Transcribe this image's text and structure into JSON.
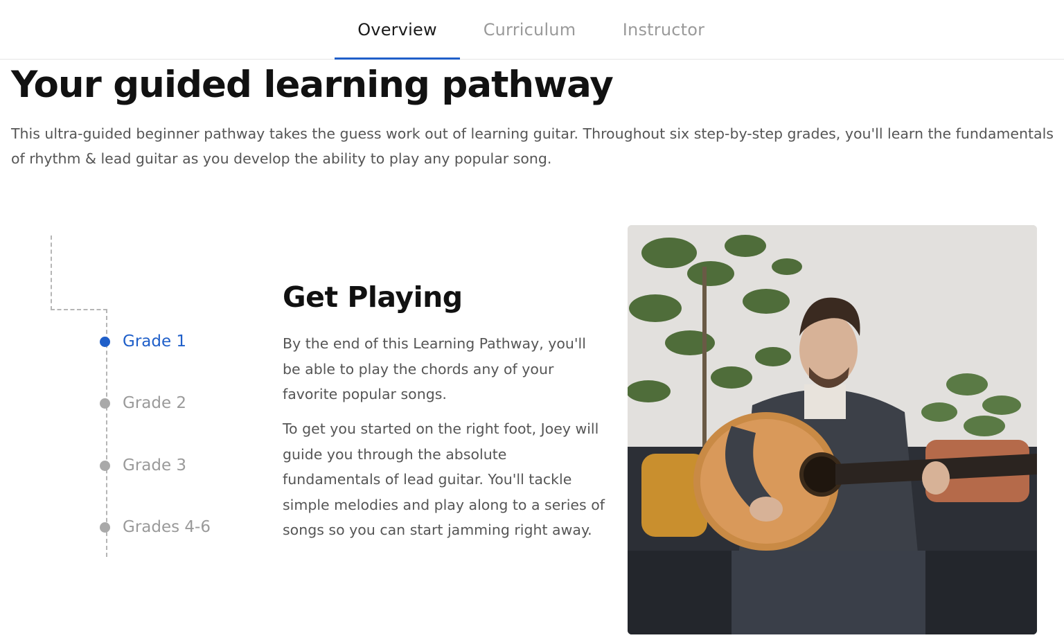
{
  "tabs": [
    {
      "label": "Overview",
      "active": true
    },
    {
      "label": "Curriculum",
      "active": false
    },
    {
      "label": "Instructor",
      "active": false
    }
  ],
  "header": {
    "title": "Your guided learning pathway",
    "intro": "This ultra-guided beginner pathway takes the guess work out of learning guitar. Throughout six step-by-step grades, you'll learn the fundamentals of rhythm & lead guitar as you develop the ability to play any popular song."
  },
  "grades": [
    {
      "label": "Grade 1",
      "active": true
    },
    {
      "label": "Grade 2",
      "active": false
    },
    {
      "label": "Grade 3",
      "active": false
    },
    {
      "label": "Grades 4-6",
      "active": false
    }
  ],
  "content": {
    "title": "Get Playing",
    "paragraph1": "By the end of this Learning Pathway, you'll be able to play the chords any of your favorite popular songs.",
    "paragraph2": "To get you started on the right foot, Joey will guide you through the absolute fundamentals of lead guitar. You'll tackle simple melodies and play along to a series of songs so you can start jamming right away."
  },
  "colors": {
    "accent": "#1f5fc9",
    "inactive": "#a9a9a9",
    "text": "#555555",
    "heading": "#111111"
  }
}
